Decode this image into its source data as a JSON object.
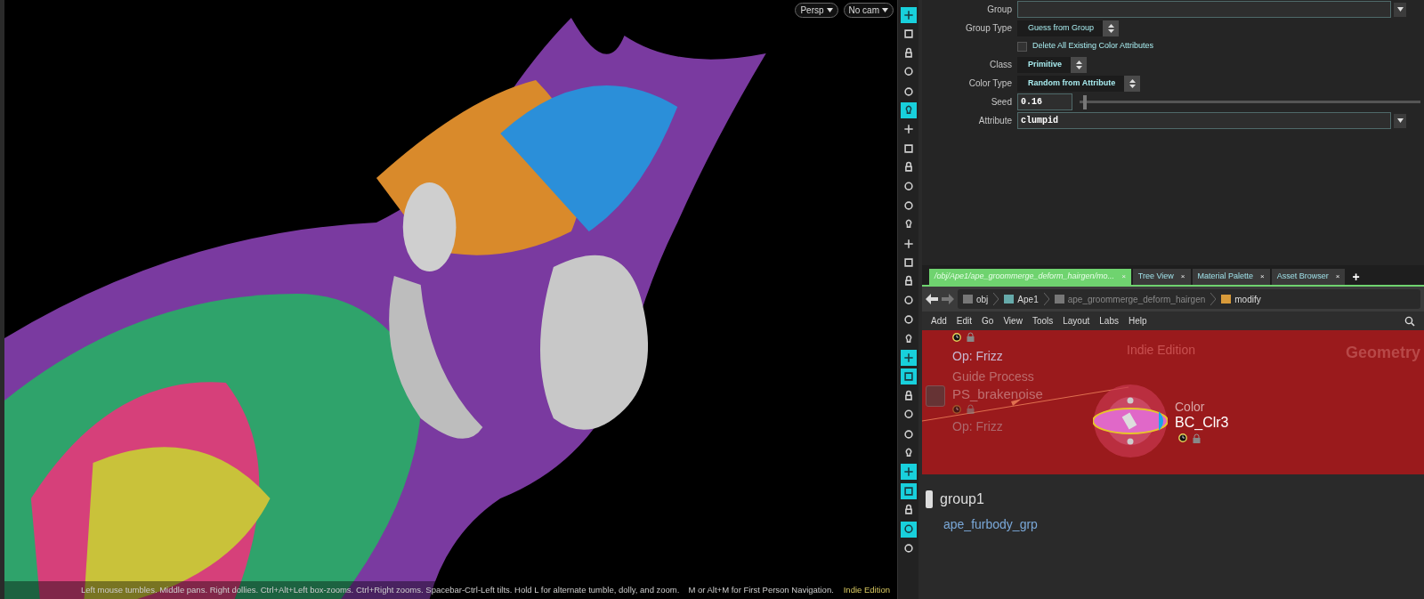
{
  "viewport": {
    "view_menus": [
      {
        "label": "Persp"
      },
      {
        "label": "No cam"
      }
    ],
    "hint": "Left mouse tumbles. Middle pans. Right dollies. Ctrl+Alt+Left box-zooms. Ctrl+Right zooms. Spacebar-Ctrl-Left tilts. Hold L for alternate tumble, dolly, and zoom.",
    "hint_2": "M or Alt+M for First Person Navigation.",
    "edition": "Indie Edition"
  },
  "toolbar": [
    {
      "selected": true
    },
    {
      "selected": false
    },
    {
      "selected": false
    },
    {
      "selected": false
    },
    {
      "selected": false
    },
    {
      "selected": true
    },
    {
      "selected": false
    },
    {
      "selected": false
    },
    {
      "selected": false
    },
    {
      "selected": false
    },
    {
      "selected": false
    },
    {
      "selected": false
    },
    {
      "selected": false
    },
    {
      "selected": false
    },
    {
      "selected": false
    },
    {
      "selected": false
    },
    {
      "selected": false
    },
    {
      "selected": false
    },
    {
      "selected": true
    },
    {
      "selected": true
    },
    {
      "selected": false
    },
    {
      "selected": false
    },
    {
      "selected": false
    },
    {
      "selected": false
    },
    {
      "selected": true
    },
    {
      "selected": true
    },
    {
      "selected": false
    },
    {
      "selected": true
    },
    {
      "selected": false
    }
  ],
  "parameters": [
    {
      "kind": "field",
      "label": "Group"
    },
    {
      "kind": "menu",
      "label": "Group Type",
      "value": "Guess from Group",
      "bold": false
    },
    {
      "kind": "checkbox",
      "label": "Delete All Existing Color Attributes",
      "checked": false
    },
    {
      "kind": "menu",
      "label": "Class",
      "value": "Primitive",
      "bold": true
    },
    {
      "kind": "menu",
      "label": "Color Type",
      "value": "Random from Attribute",
      "bold": true
    },
    {
      "kind": "slider",
      "label": "Seed",
      "value": "0.16",
      "level": 0.01
    },
    {
      "kind": "field",
      "label": "Attribute",
      "value": "clumpid"
    }
  ],
  "tabs": [
    {
      "label": "/obj/Ape1/ape_groommerge_deform_hairgen/mo...",
      "selected": true
    },
    {
      "label": "Tree View",
      "selected": false
    },
    {
      "label": "Material Palette",
      "selected": false
    },
    {
      "label": "Asset Browser",
      "selected": false
    }
  ],
  "tab_add": "+",
  "tab_close": "×",
  "path": [
    "obj",
    "Ape1",
    "ape_groommerge_deform_hairgen",
    "modify"
  ],
  "menu": [
    "Add",
    "Edit",
    "Go",
    "View",
    "Tools",
    "Layout",
    "Labs",
    "Help"
  ],
  "network": {
    "edition": "Indie Edition",
    "context": "Geometry",
    "nodes": [
      {
        "kind": "partial",
        "op": "Op: Frizz"
      },
      {
        "kind": "faded",
        "type": "Guide Process",
        "name": "PS_brakenoise",
        "op": "Op: Frizz"
      },
      {
        "kind": "selected",
        "type": "Color",
        "name": "BC_Clr3"
      }
    ],
    "group": {
      "name": "group1",
      "pattern": "ape_furbody_grp"
    }
  }
}
